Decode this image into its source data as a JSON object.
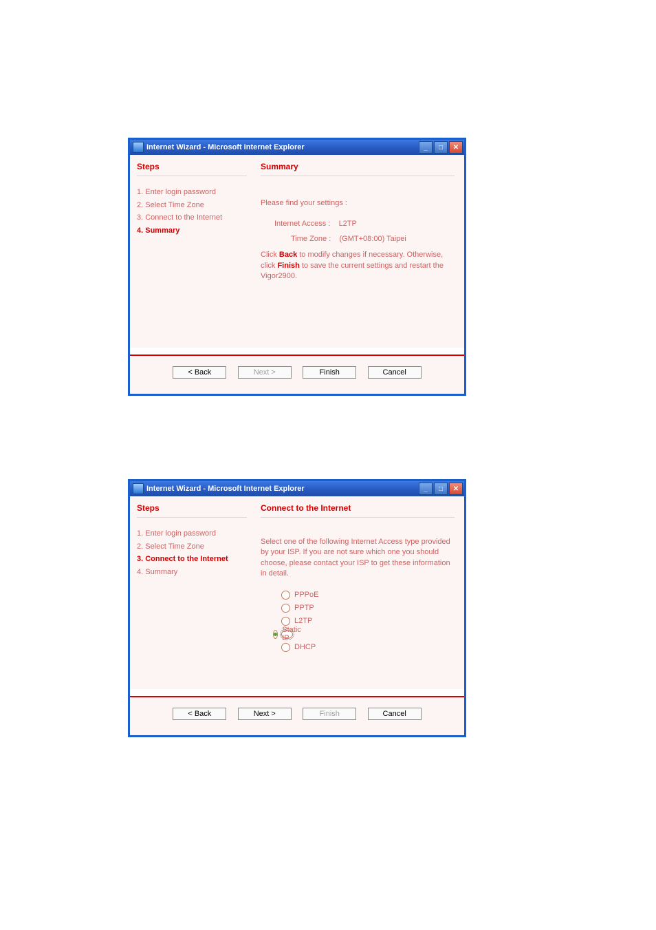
{
  "window1": {
    "title": "Internet Wizard - Microsoft Internet Explorer",
    "stepsHeader": "Steps",
    "steps": {
      "s1": "1. Enter login password",
      "s2": "2. Select Time Zone",
      "s3": "3. Connect to the Internet",
      "s4": "4. Summary"
    },
    "mainHeader": "Summary",
    "intro": "Please find your settings :",
    "kv": {
      "accessLabel": "Internet Access :",
      "accessValue": "L2TP",
      "tzLabel": "Time Zone :",
      "tzValue": "(GMT+08:00) Taipei"
    },
    "instruction_pre": "Click ",
    "instruction_b1": "Back",
    "instruction_mid": " to modify changes if necessary. Otherwise, click ",
    "instruction_b2": "Finish",
    "instruction_post": " to save the current settings and restart the Vigor2900.",
    "buttons": {
      "back": "< Back",
      "next": "Next >",
      "finish": "Finish",
      "cancel": "Cancel"
    }
  },
  "window2": {
    "title": "Internet Wizard - Microsoft Internet Explorer",
    "stepsHeader": "Steps",
    "steps": {
      "s1": "1. Enter login password",
      "s2": "2. Select Time Zone",
      "s3": "3. Connect to the Internet",
      "s4": "4. Summary"
    },
    "mainHeader": "Connect to the Internet",
    "intro": "Select one of the following Internet Access type provided by your ISP. If you are not sure which one you should choose, please contact your ISP to get these information in detail.",
    "options": {
      "o1": "PPPoE",
      "o2": "PPTP",
      "o3": "L2TP",
      "o4": "Static IP",
      "o5": "DHCP"
    },
    "buttons": {
      "back": "< Back",
      "next": "Next >",
      "finish": "Finish",
      "cancel": "Cancel"
    }
  }
}
